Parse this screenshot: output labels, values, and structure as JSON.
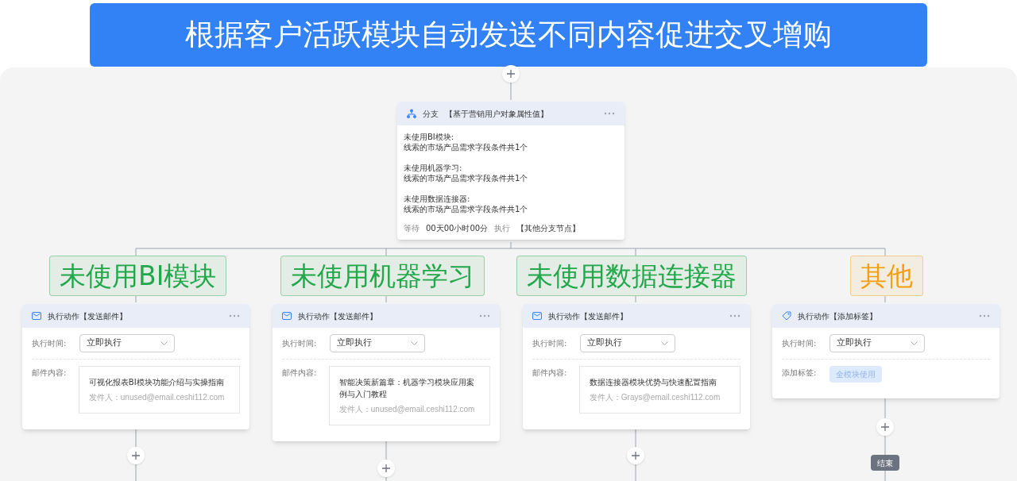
{
  "banner": {
    "title": "根据客户活跃模块自动发送不同内容促进交叉增购"
  },
  "branch_node": {
    "title": "分支",
    "tag": "【基于营销用户对象属性值】",
    "conditions": [
      {
        "name": "未使用BI模块:",
        "desc": "线索的市场产品需求字段条件共1个"
      },
      {
        "name": "未使用机器学习:",
        "desc": "线索的市场产品需求字段条件共1个"
      },
      {
        "name": "未使用数据连接器:",
        "desc": "线索的市场产品需求字段条件共1个"
      }
    ],
    "wait_label": "等待",
    "wait_value": "00天00小时00分",
    "exec_label": "执行",
    "exec_target": "【其他分支节点】"
  },
  "branches": [
    {
      "label": "未使用BI模块",
      "color": "#22a84a",
      "action": {
        "kind": "email",
        "title": "执行动作【发送邮件】",
        "time_label": "执行时间:",
        "time_value": "立即执行",
        "content_label": "邮件内容:",
        "subject": "可视化报表BI模块功能介绍与实操指南",
        "sender": "发件人：unused@email.ceshi112.com"
      }
    },
    {
      "label": "未使用机器学习",
      "color": "#22a84a",
      "action": {
        "kind": "email",
        "title": "执行动作【发送邮件】",
        "time_label": "执行时间:",
        "time_value": "立即执行",
        "content_label": "邮件内容:",
        "subject": "智能决策新篇章：机器学习模块应用案例与入门教程",
        "sender": "发件人：unused@email.ceshi112.com"
      }
    },
    {
      "label": "未使用数据连接器",
      "color": "#22a84a",
      "action": {
        "kind": "email",
        "title": "执行动作【发送邮件】",
        "time_label": "执行时间:",
        "time_value": "立即执行",
        "content_label": "邮件内容:",
        "subject": "数据连接器模块优势与快速配置指南",
        "sender": "发件人：Grays@email.ceshi112.com"
      }
    },
    {
      "label": "其他",
      "color": "#f59e0b",
      "action": {
        "kind": "tag",
        "title": "执行动作【添加标签】",
        "time_label": "执行时间:",
        "time_value": "立即执行",
        "content_label": "添加标签:",
        "tag": "全模块使用"
      },
      "end_label": "结束"
    }
  ]
}
